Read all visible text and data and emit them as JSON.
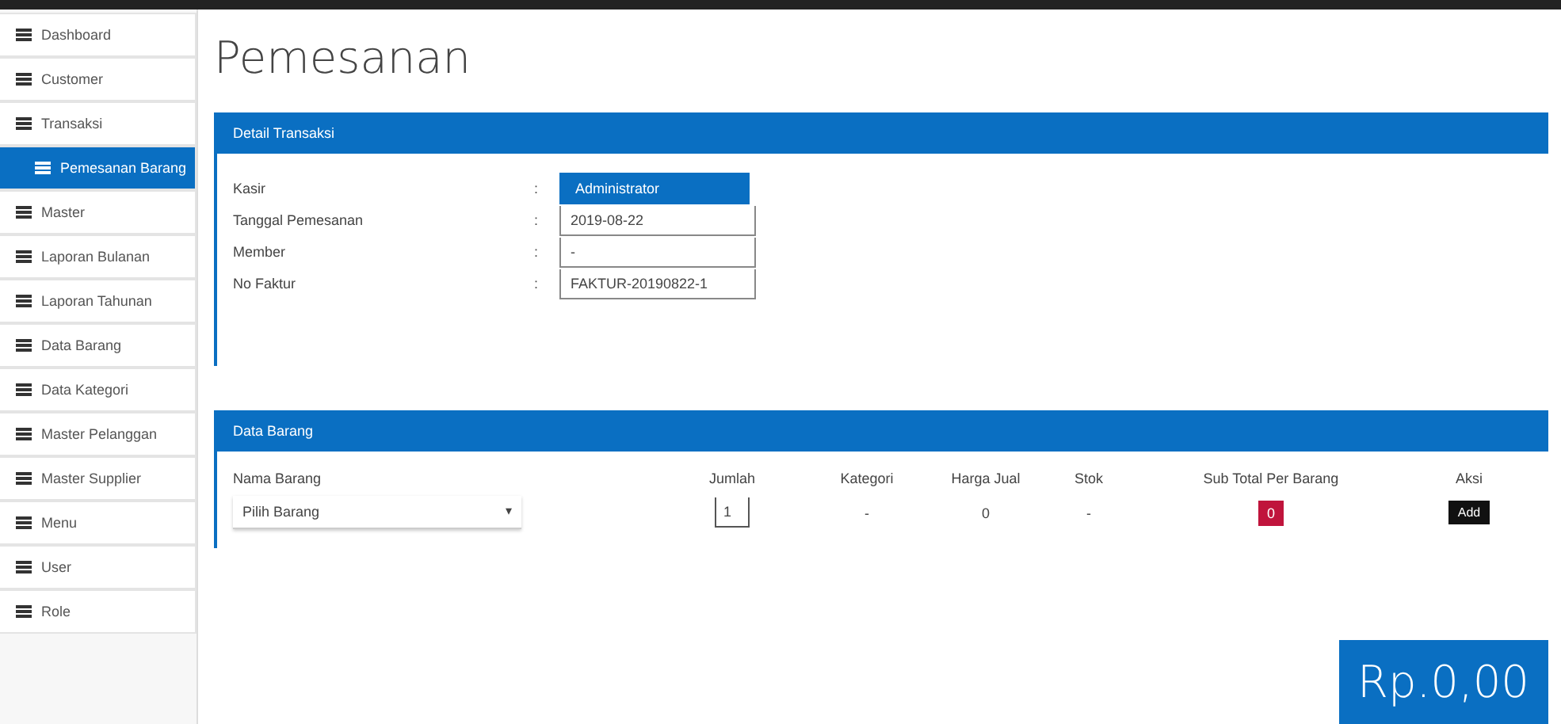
{
  "sidebar": {
    "items": [
      {
        "label": "Dashboard",
        "selected": false
      },
      {
        "label": "Customer",
        "selected": false
      },
      {
        "label": "Transaksi",
        "selected": false,
        "children": [
          {
            "label": "Pemesanan Barang",
            "selected": true
          }
        ]
      },
      {
        "label": "Master",
        "selected": false
      },
      {
        "label": "Laporan Bulanan",
        "selected": false
      },
      {
        "label": "Laporan Tahunan",
        "selected": false
      },
      {
        "label": "Data Barang",
        "selected": false
      },
      {
        "label": "Data Kategori",
        "selected": false
      },
      {
        "label": "Master Pelanggan",
        "selected": false
      },
      {
        "label": "Master Supplier",
        "selected": false
      },
      {
        "label": "Menu",
        "selected": false
      },
      {
        "label": "User",
        "selected": false
      },
      {
        "label": "Role",
        "selected": false
      }
    ]
  },
  "page_title": "Pemesanan",
  "detail_panel": {
    "title": "Detail Transaksi",
    "fields": [
      {
        "label": "Kasir",
        "separator": ":",
        "value": "Administrator",
        "kind": "badge"
      },
      {
        "label": "Tanggal Pemesanan",
        "separator": ":",
        "value": "2019-08-22",
        "kind": "text"
      },
      {
        "label": "Member",
        "separator": ":",
        "value": "-",
        "kind": "text"
      },
      {
        "label": "No Faktur",
        "separator": ":",
        "value": "FAKTUR-20190822-1",
        "kind": "text"
      }
    ]
  },
  "items_panel": {
    "title": "Data Barang",
    "columns": [
      "Nama Barang",
      "Jumlah",
      "Kategori",
      "Harga Jual",
      "Stok",
      "Sub Total Per Barang",
      "Aksi"
    ],
    "row": {
      "product_select": "Pilih Barang",
      "select_caret": "▾",
      "quantity": "1",
      "category": "-",
      "price": "0",
      "stock": "-",
      "subtotal": "0",
      "action": "Add"
    }
  },
  "total": "Rp.0,00"
}
